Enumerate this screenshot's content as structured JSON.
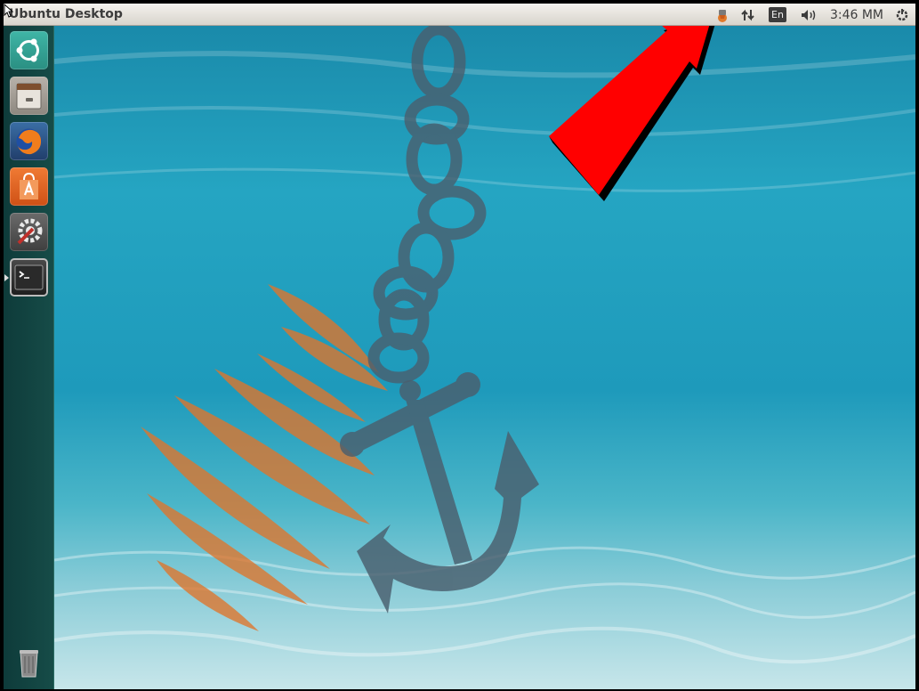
{
  "panel": {
    "title": "Ubuntu Desktop",
    "clock": "3:46 MM",
    "keyboard_layout": "En"
  },
  "launcher": {
    "items": [
      {
        "name": "dash-home",
        "icon": "ubuntu-logo-icon",
        "color": "#3aa89a"
      },
      {
        "name": "files",
        "icon": "file-cabinet-icon",
        "color": "#9a9590"
      },
      {
        "name": "firefox",
        "icon": "firefox-icon",
        "color": "#2a4d7a"
      },
      {
        "name": "software-center",
        "icon": "shopping-bag-icon",
        "color": "#e2631f"
      },
      {
        "name": "system-settings",
        "icon": "settings-wrench-icon",
        "color": "#5b5b5b"
      },
      {
        "name": "terminal",
        "icon": "terminal-icon",
        "color": "#2b2b2b"
      },
      {
        "name": "trash",
        "icon": "trash-icon",
        "color": "#6a6a6a"
      }
    ],
    "active_item": "terminal"
  },
  "desktop": {
    "wallpaper": "underwater-anchor-wallpaper",
    "accent_color": "#e0752b",
    "annotation_arrow_color": "#ff0000"
  }
}
